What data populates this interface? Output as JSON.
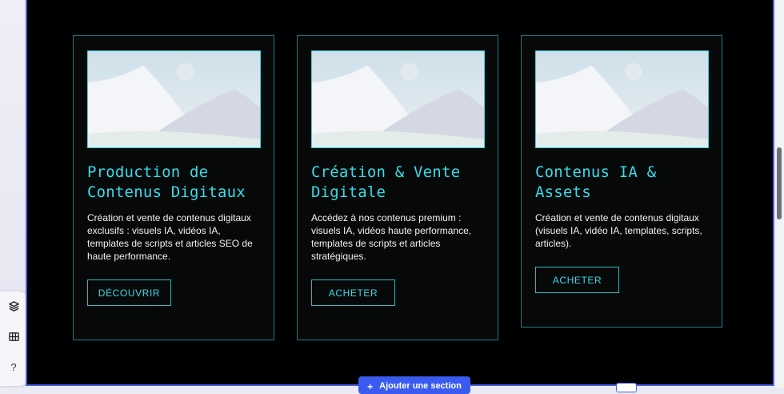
{
  "cards": [
    {
      "title": "Production de Contenus Digitaux",
      "description": "Création et vente de contenus digitaux exclusifs : visuels IA, vidéos IA, templates de scripts et articles SEO de haute performance.",
      "button_label": "DÉCOUVRIR"
    },
    {
      "title": "Création & Vente Digitale",
      "description": "Accédez à nos contenus premium : visuels IA, vidéos haute performance, templates de scripts et articles stratégiques.",
      "button_label": "ACHETER"
    },
    {
      "title": "Contenus IA & Assets",
      "description": "Création et vente de contenus digitaux (visuels IA, vidéo IA, templates, scripts, articles).",
      "button_label": "ACHETER"
    }
  ],
  "editor": {
    "add_section_label": "Ajouter une section",
    "help_label": "?",
    "tools": [
      "layers-icon",
      "grid-icon",
      "help-icon"
    ]
  },
  "colors": {
    "accent": "#36dcea",
    "canvas_bg": "#000000",
    "selection": "#4b5fe6",
    "add_section_bg": "#3b5bf0"
  }
}
